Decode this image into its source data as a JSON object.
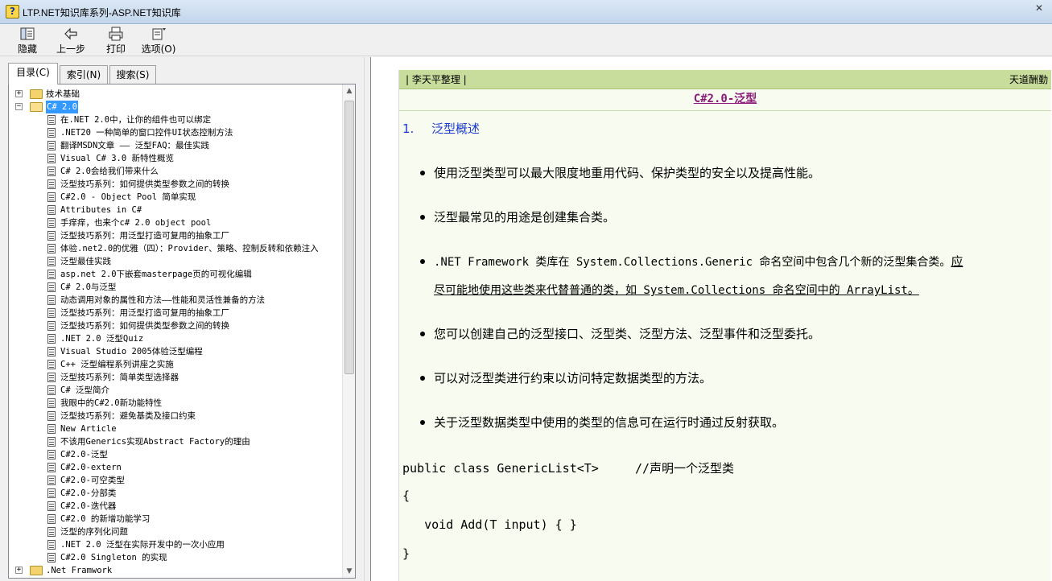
{
  "window": {
    "title": "LTP.NET知识库系列-ASP.NET知识库",
    "controls": {
      "minimize": "–",
      "maximize": "□",
      "close": "✕"
    }
  },
  "toolbar": {
    "hide": "隐藏",
    "back": "上一步",
    "print": "打印",
    "options": "选项(O)"
  },
  "tabs": [
    "目录(C)",
    "索引(N)",
    "搜索(S)"
  ],
  "tree": {
    "nodes": [
      {
        "label": "技术基础",
        "toggle": "+",
        "expanded": false
      },
      {
        "label": "C# 2.0",
        "toggle": "−",
        "expanded": true,
        "selected": true
      },
      {
        "label": ".Net Framwork",
        "toggle": "+",
        "expanded": false
      }
    ],
    "children": [
      "在.NET 2.0中，让你的组件也可以绑定",
      ".NET20 一种简单的窗口控件UI状态控制方法",
      "翻译MSDN文章 —— 泛型FAQ：最佳实践",
      "Visual C# 3.0 新特性概览",
      "C# 2.0会给我们带来什么",
      "泛型技巧系列：如何提供类型参数之间的转换",
      "C#2.0 - Object Pool 简单实现",
      "Attributes in C#",
      "手痒痒，也来个c# 2.0 object pool",
      "泛型技巧系列：用泛型打造可复用的抽象工厂",
      "体验.net2.0的优雅（四）：Provider、策略、控制反转和依赖注入",
      "泛型最佳实践",
      "asp.net 2.0下嵌套masterpage页的可视化编辑",
      "C# 2.0与泛型",
      "动态调用对象的属性和方法——性能和灵活性兼备的方法",
      "泛型技巧系列：用泛型打造可复用的抽象工厂",
      "泛型技巧系列：如何提供类型参数之间的转换",
      ".NET 2.0 泛型Quiz",
      "Visual Studio 2005体验泛型编程",
      "C++ 泛型编程系列讲座之实施",
      "泛型技巧系列：简单类型选择器",
      "C# 泛型简介",
      "我眼中的C#2.0新功能特性",
      "泛型技巧系列：避免基类及接口约束",
      "New Article",
      "不该用Generics实现Abstract Factory的理由",
      "C#2.0-泛型",
      "C#2.0-extern",
      "C#2.0-可空类型",
      "C#2.0-分部类",
      "C#2.0-迭代器",
      "C#2.0 的新增功能学习",
      "泛型的序列化问题",
      ".NET 2.0 泛型在实际开发中的一次小应用",
      "C#2.0 Singleton 的实现"
    ]
  },
  "content": {
    "header_left": "|  李天平整理  |",
    "header_right": "天道酬勤",
    "title": "C#2.0-泛型",
    "section_num": "1.",
    "section_title": "泛型概述",
    "bullets": [
      "使用泛型类型可以最大限度地重用代码、保护类型的安全以及提高性能。",
      "泛型最常见的用途是创建集合类。"
    ],
    "bullet3": {
      "a": ".NET Framework 类库在 System.Collections.Generic 命名空间中包含几个新的泛型集合类。",
      "b": "应",
      "c": "尽可能地使用这些类来代替普通的类，如 System.Collections 命名空间中的 ArrayList。"
    },
    "bullets_more": [
      "您可以创建自己的泛型接口、泛型类、泛型方法、泛型事件和泛型委托。",
      "可以对泛型类进行约束以访问特定数据类型的方法。",
      "关于泛型数据类型中使用的类型的信息可在运行时通过反射获取。"
    ],
    "code": [
      "public class GenericList<T>     //声明一个泛型类",
      "{",
      "   void Add(T input) { }",
      "}"
    ]
  },
  "colors": {
    "header_bg": "#c8dd9c",
    "doc_bg": "#f8fbef",
    "title_color": "#8b1a7a",
    "section_color": "#1a3ad4",
    "selection": "#3399ff"
  },
  "icons": [
    "help-app-icon",
    "hide-icon",
    "back-arrow-icon",
    "print-icon",
    "options-icon",
    "folder-icon",
    "document-icon"
  ]
}
